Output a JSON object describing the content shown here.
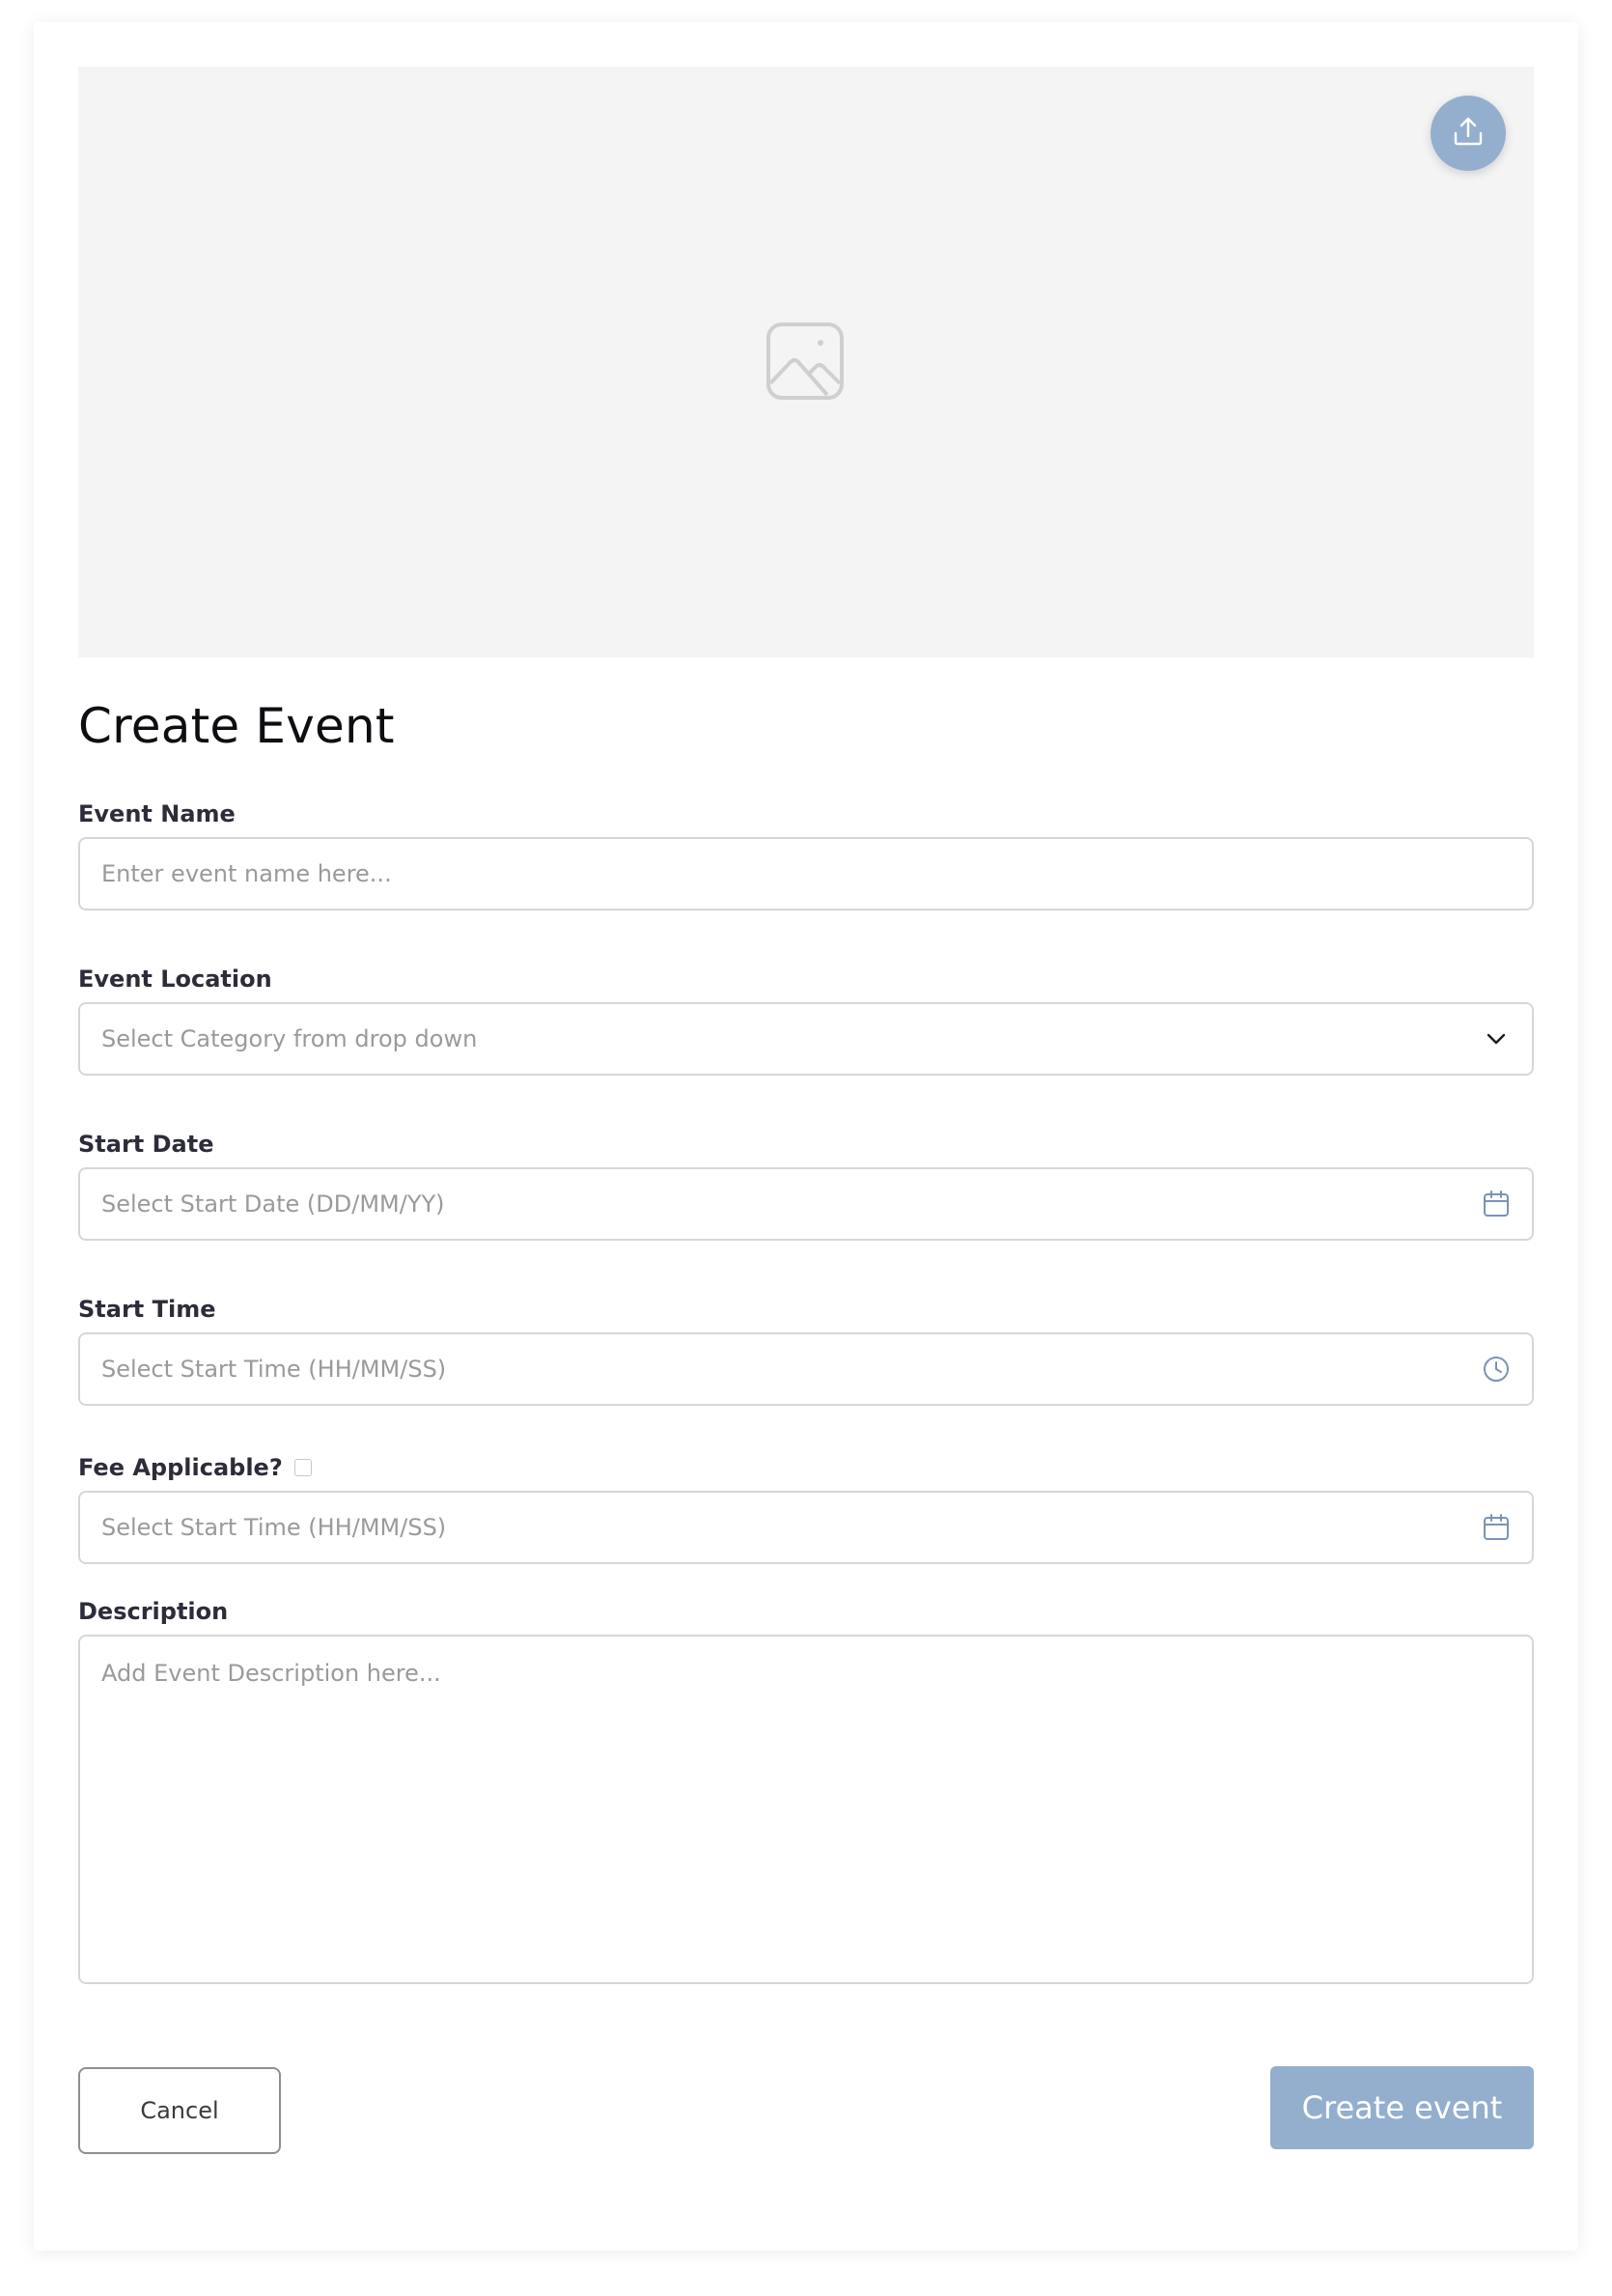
{
  "page": {
    "title": "Create Event"
  },
  "banner": {
    "upload_icon": "upload-icon",
    "placeholder_icon": "image-placeholder-icon"
  },
  "form": {
    "event_name": {
      "label": "Event Name",
      "placeholder": "Enter event name here..."
    },
    "event_location": {
      "label": "Event Location",
      "placeholder": "Select Category from drop down",
      "icon": "chevron-down-icon"
    },
    "start_date": {
      "label": "Start Date",
      "placeholder": "Select Start Date (DD/MM/YY)",
      "icon": "calendar-icon"
    },
    "start_time": {
      "label": "Start Time",
      "placeholder": "Select Start Time (HH/MM/SS)",
      "icon": "clock-icon"
    },
    "fee": {
      "label": "Fee Applicable?",
      "checked": false,
      "placeholder": "Select Start Time (HH/MM/SS)",
      "icon": "calendar-icon"
    },
    "description": {
      "label": "Description",
      "placeholder": "Add Event Description here..."
    }
  },
  "actions": {
    "cancel_label": "Cancel",
    "create_label": "Create event"
  },
  "colors": {
    "accent": "#94aece",
    "banner_bg": "#f4f4f4",
    "border": "#d6d6d6",
    "placeholder_text": "#9a9a9a",
    "icon": "#7a93b4"
  }
}
